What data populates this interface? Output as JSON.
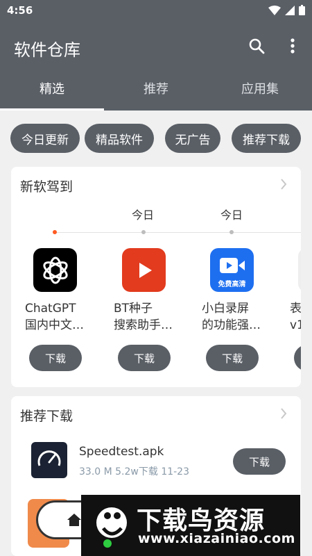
{
  "status_bar": {
    "time": "4:56"
  },
  "app_bar": {
    "title": "软件仓库"
  },
  "tabs": [
    {
      "label": "精选",
      "active": true
    },
    {
      "label": "推荐",
      "active": false
    },
    {
      "label": "应用集",
      "active": false
    }
  ],
  "chips": [
    "今日更新",
    "精品软件",
    "无广告",
    "推荐下载"
  ],
  "new_apps": {
    "title": "新软驾到",
    "dates": [
      "今日",
      "今日"
    ],
    "apps": [
      {
        "line1": "ChatGPT",
        "line2": "国内中文…",
        "button": "下载",
        "icon": "chatgpt-icon"
      },
      {
        "line1": "BT种子",
        "line2": "搜索助手…",
        "button": "下载",
        "icon": "play-icon"
      },
      {
        "line1": "小白录屏",
        "line2": "的功能强…",
        "button": "下载",
        "icon": "video-camera-icon",
        "icon_text": "免费高清"
      },
      {
        "line1": "表",
        "line2": "v1",
        "button": "",
        "icon": "partial-app-icon"
      }
    ]
  },
  "recommended": {
    "title": "推荐下载",
    "item": {
      "name": "Speedtest.apk",
      "meta": "33.0 M  5.2w下载  11-23",
      "button": "下载",
      "icon": "speedometer-icon"
    }
  },
  "watermark": {
    "text": "下载鸟资源",
    "url": "www.xiazainiao.com"
  },
  "colors": {
    "primary": "#5a5f66",
    "accent_dot": "#ff5a22",
    "background": "#f0f0f0"
  }
}
